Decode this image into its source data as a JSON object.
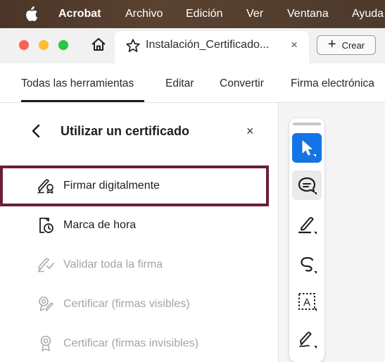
{
  "menubar": {
    "apple_icon": "apple-logo-icon",
    "app_name": "Acrobat",
    "items": [
      "Archivo",
      "Edición",
      "Ver",
      "Ventana",
      "Ayuda"
    ]
  },
  "tabbar": {
    "traffic_lights": [
      "#fe5f57",
      "#febc2e",
      "#28c840"
    ],
    "home_icon": "home-icon",
    "tab_icon": "star-icon",
    "tab_title": "Instalación_Certificado...",
    "tab_close": "×",
    "create_label": "Crear",
    "create_plus": "+"
  },
  "toolsnav": {
    "items": [
      "Todas las herramientas",
      "Editar",
      "Convertir",
      "Firma electrónica"
    ],
    "active_index": 0
  },
  "panel": {
    "title": "Utilizar un certificado",
    "close": "×",
    "items": [
      {
        "label": "Firmar digitalmente",
        "icon": "sign-digitally-icon",
        "enabled": true,
        "highlighted": true
      },
      {
        "label": "Marca de hora",
        "icon": "timestamp-icon",
        "enabled": true
      },
      {
        "label": "Validar toda la firma",
        "icon": "validate-signature-icon",
        "enabled": false
      },
      {
        "label": "Certificar (firmas visibles)",
        "icon": "certify-visible-icon",
        "enabled": false
      },
      {
        "label": "Certificar (firmas invisibles)",
        "icon": "certify-invisible-icon",
        "enabled": false
      }
    ],
    "highlight_color": "#6b1f33"
  },
  "toolbar": {
    "tools": [
      {
        "icon": "select-cursor-icon",
        "active": true
      },
      {
        "icon": "comment-icon",
        "active": false
      },
      {
        "icon": "highlight-pen-icon",
        "active": false
      },
      {
        "icon": "freehand-draw-icon",
        "active": false
      },
      {
        "icon": "text-box-icon",
        "active": false,
        "glyph": "A"
      },
      {
        "icon": "sign-icon",
        "active": false
      }
    ],
    "active_color": "#1473e6"
  }
}
